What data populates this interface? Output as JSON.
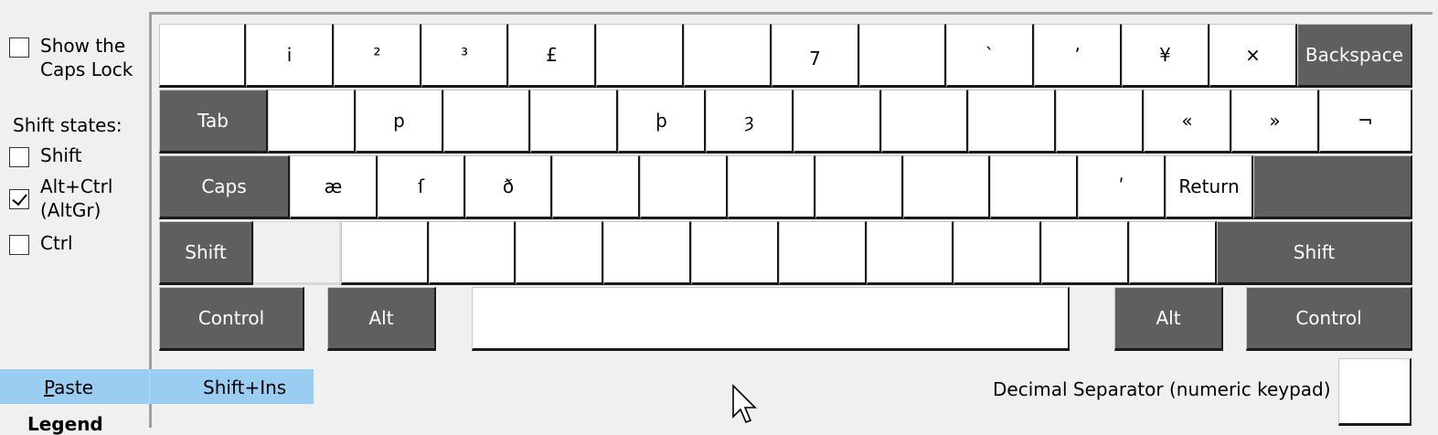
{
  "options": {
    "caps_lock": {
      "label": "Show the\nCaps Lock",
      "checked": false
    },
    "shift_states_title": "Shift states:",
    "shift": {
      "label": "Shift",
      "checked": false
    },
    "altgr": {
      "label": "Alt+Ctrl\n(AltGr)",
      "checked": true
    },
    "ctrl": {
      "label": "Ctrl",
      "checked": false
    }
  },
  "keyboard": {
    "row1": [
      "",
      "i",
      "²",
      "³",
      "£",
      "",
      "",
      "7",
      "",
      "`",
      "ʼ",
      "¥",
      "×",
      "Backspace"
    ],
    "row2": [
      "Tab",
      "",
      "p",
      "",
      "",
      "þ",
      "ȝ",
      "",
      "",
      "",
      "",
      "«",
      "»",
      "¬"
    ],
    "row3": [
      "Caps",
      "æ",
      "ſ",
      "ð",
      "",
      "",
      "",
      "",
      "",
      "",
      "ʹ",
      "Return"
    ],
    "row4": [
      "Shift",
      "",
      "",
      "",
      "",
      "",
      "",
      "",
      "",
      "",
      "",
      "",
      "Shift"
    ],
    "row5": [
      "Control",
      "Alt",
      "",
      "Alt",
      "Control"
    ]
  },
  "context_menu": {
    "item_label": "Paste",
    "item_accel_letter": "P",
    "item_rest": "aste",
    "shortcut": "Shift+Ins"
  },
  "legend_label": "Legend",
  "decimal_separator": {
    "label": "Decimal Separator (numeric keypad)",
    "value": ""
  }
}
